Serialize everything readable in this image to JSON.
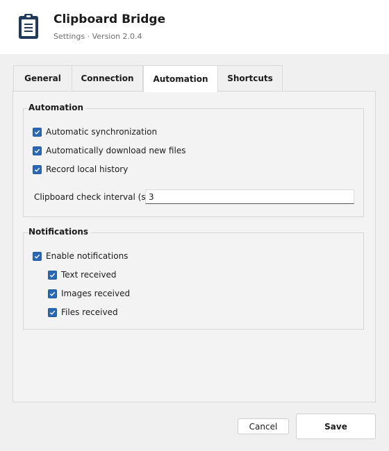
{
  "app": {
    "title": "Clipboard Bridge",
    "subtitle": "Settings · Version 2.0.4",
    "icon": "clipboard-icon"
  },
  "tabs": [
    {
      "label": "General",
      "active": false
    },
    {
      "label": "Connection",
      "active": false
    },
    {
      "label": "Automation",
      "active": true
    },
    {
      "label": "Shortcuts",
      "active": false
    }
  ],
  "automation": {
    "title": "Automation",
    "options": [
      {
        "label": "Automatic synchronization",
        "checked": true
      },
      {
        "label": "Automatically download new files",
        "checked": true
      },
      {
        "label": "Record local history",
        "checked": true
      }
    ],
    "interval_label": "Clipboard check interval (s)",
    "interval_value": "3"
  },
  "notifications": {
    "title": "Notifications",
    "enable_label": "Enable notifications",
    "enable_checked": true,
    "items": [
      {
        "label": "Text received",
        "checked": true
      },
      {
        "label": "Images received",
        "checked": true
      },
      {
        "label": "Files received",
        "checked": true
      }
    ]
  },
  "buttons": {
    "cancel": "Cancel",
    "save": "Save"
  },
  "colors": {
    "accent": "#2a68b5",
    "header_bg": "#ffffff",
    "window_bg": "#f0f0f0"
  }
}
